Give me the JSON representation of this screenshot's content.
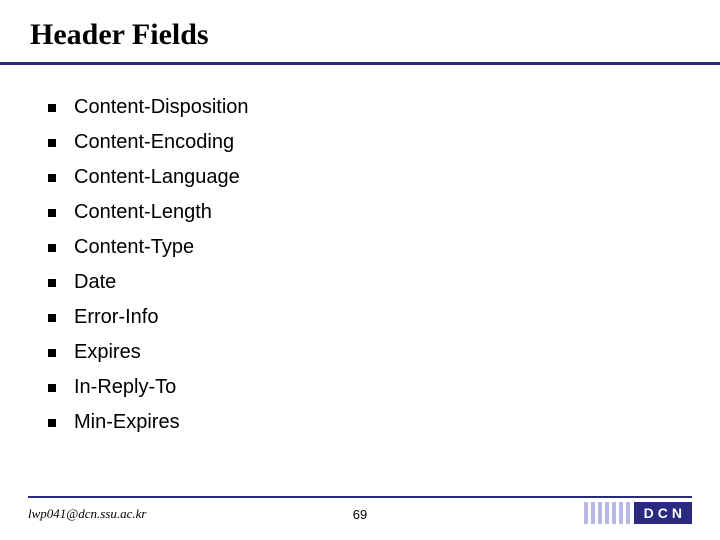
{
  "title": "Header Fields",
  "items": [
    "Content-Disposition",
    "Content-Encoding",
    "Content-Language",
    "Content-Length",
    "Content-Type",
    "Date",
    "Error-Info",
    "Expires",
    "In-Reply-To",
    "Min-Expires"
  ],
  "footer": {
    "left": "lwp041@dcn.ssu.ac.kr",
    "center": "69",
    "right_label": "DCN"
  }
}
